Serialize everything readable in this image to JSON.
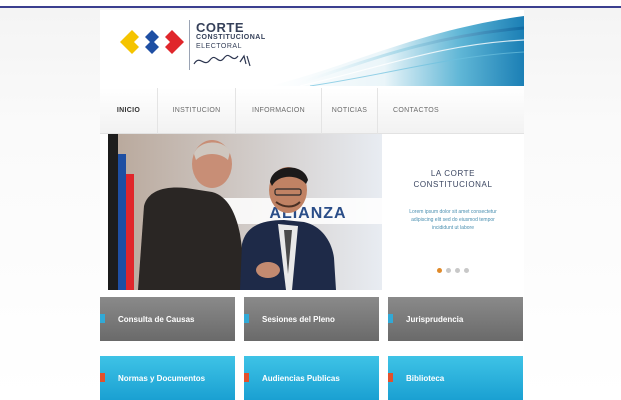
{
  "header": {
    "logo_line1": "CORTE",
    "logo_line2": "CONSTITUCIONAL",
    "logo_line3": "ELECTORAL",
    "logo_sign": "Wind · 2014"
  },
  "nav": {
    "items": [
      {
        "label": "Inicio",
        "active": true
      },
      {
        "label": "Institucion",
        "active": false
      },
      {
        "label": "Informacion",
        "active": false
      },
      {
        "label": "Noticias",
        "active": false
      },
      {
        "label": "Contactos",
        "active": false
      }
    ]
  },
  "hero": {
    "banner_text": "ALIANZA"
  },
  "promo": {
    "title_line1": "LA CORTE",
    "title_line2": "CONSTITUCIONAL",
    "body": "Lorem ipsum dolor sit amet consectetur adipiscing elit sed do eiusmod tempor incididunt ut labore",
    "pager_count": 4,
    "pager_active": 1
  },
  "tiles": [
    {
      "label": "Consulta de Causas",
      "style": "gray"
    },
    {
      "label": "Sesiones del Pleno",
      "style": "gray"
    },
    {
      "label": "Jurisprudencia",
      "style": "gray"
    },
    {
      "label": "Normas y Documentos",
      "style": "blue"
    },
    {
      "label": "Audiencias Publicas",
      "style": "blue"
    },
    {
      "label": "Biblioteca",
      "style": "blue"
    }
  ],
  "colors": {
    "logo_yellow": "#f5c400",
    "logo_blue": "#1e4fa3",
    "logo_red": "#e0262b",
    "tile_gray": "#777777",
    "tile_blue": "#22a8d8",
    "accent_orange": "#e08a2a"
  }
}
